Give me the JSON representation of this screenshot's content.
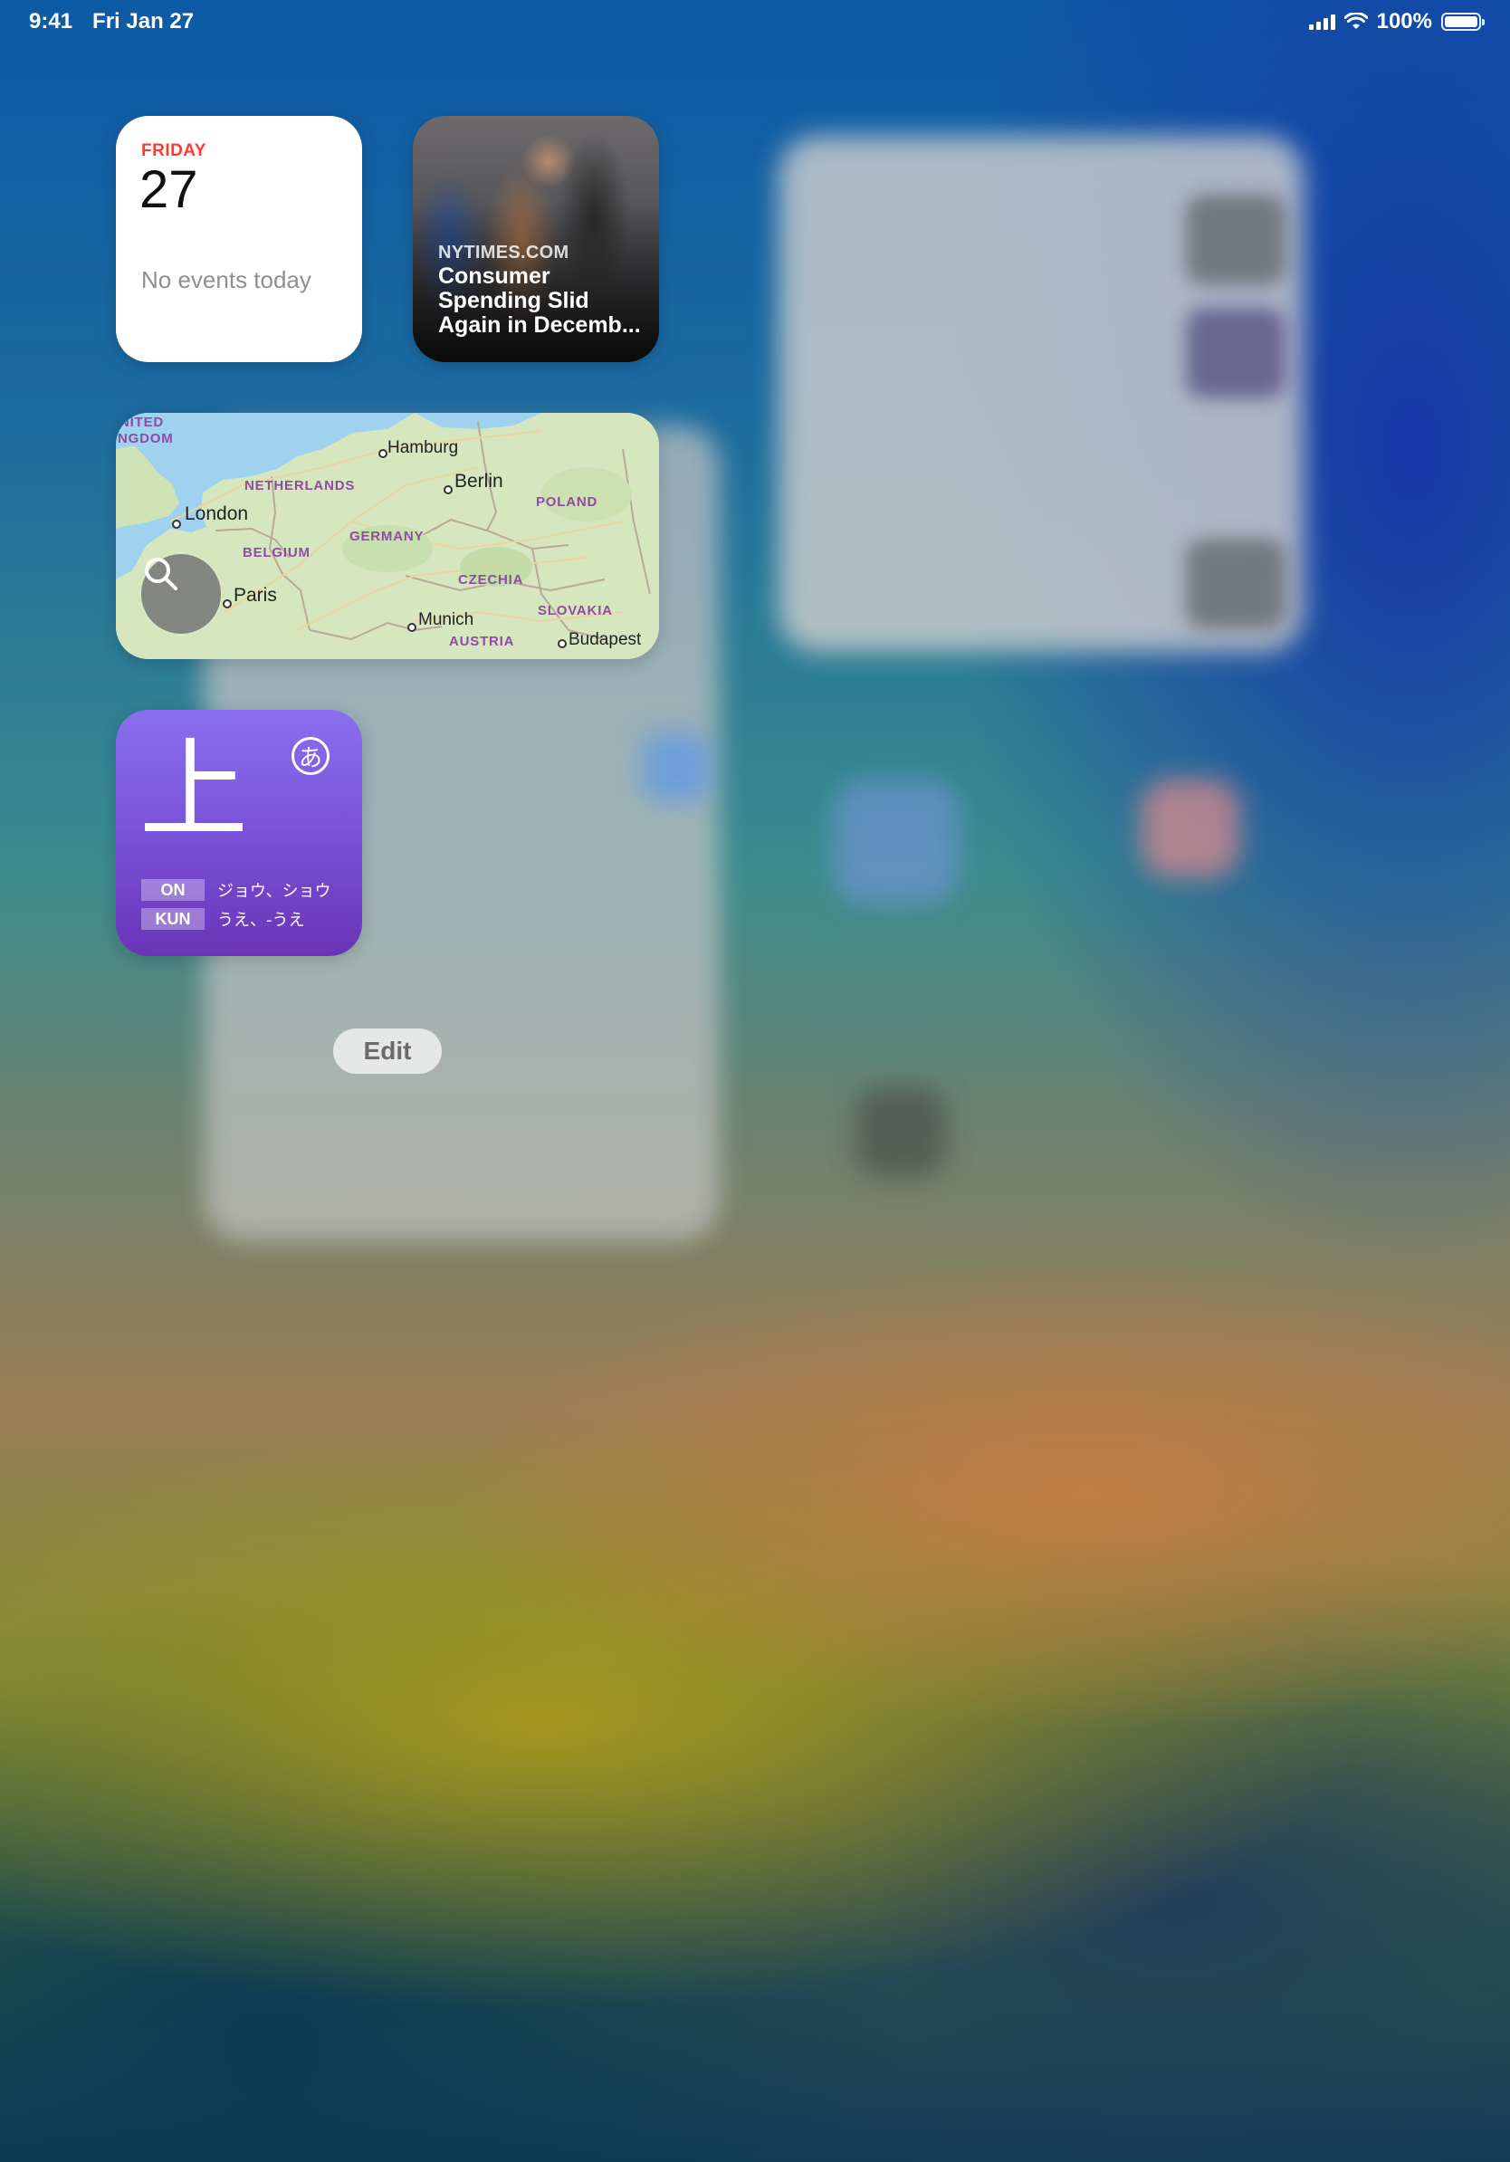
{
  "status_bar": {
    "time": "9:41",
    "date": "Fri Jan 27",
    "battery": "100%"
  },
  "widgets": {
    "calendar": {
      "weekday": "FRIDAY",
      "day": "27",
      "empty_message": "No events today",
      "accent_color": "#ff3b30"
    },
    "news": {
      "source": "NYTIMES.COM",
      "headline": "Consumer Spending Slid Again in Decemb..."
    },
    "map": {
      "cities": [
        "Hamburg",
        "Berlin",
        "London",
        "Paris",
        "Munich",
        "Budapest"
      ],
      "countries": [
        "NITED",
        "NGDOM",
        "NETHERLANDS",
        "POLAND",
        "GERMANY",
        "BELGIUM",
        "CZECHIA",
        "SLOVAKIA",
        "AUSTRIA"
      ],
      "search_icon": "search-icon"
    },
    "kanji": {
      "character": "上",
      "kana_badge": "あ",
      "on_label": "ON",
      "on_reading": "ジョウ、ショウ",
      "kun_label": "KUN",
      "kun_reading": "うえ、-うえ"
    }
  },
  "edit_label": "Edit"
}
